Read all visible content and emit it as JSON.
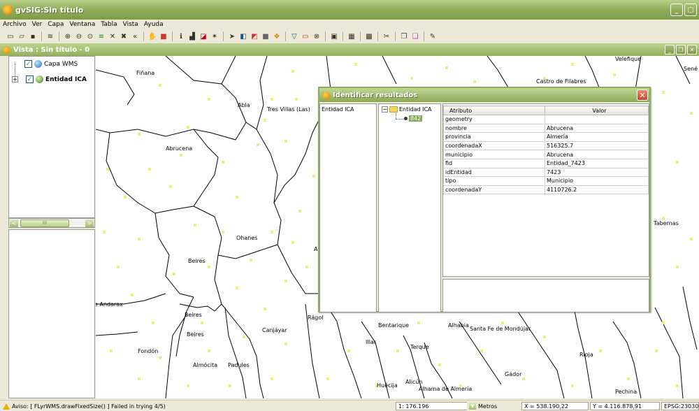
{
  "window": {
    "title": "gvSIG:Sin título"
  },
  "menu": [
    "Archivo",
    "Ver",
    "Capa",
    "Ventana",
    "Tabla",
    "Vista",
    "Ayuda"
  ],
  "view": {
    "title": "Vista : Sin título - 0"
  },
  "toc": {
    "layers": [
      {
        "name": "Capa WMS",
        "checked": "✓"
      },
      {
        "name": "Entidad ICA",
        "checked": "✓"
      }
    ],
    "expander": "+"
  },
  "scrollbar": {
    "left": "<",
    "right": ">",
    "thumb": "III"
  },
  "map": {
    "places": [
      "Fiñana",
      "Abla",
      "Tres Villas (Las)",
      "Abrucena",
      "Ohanes",
      "Beires",
      "e Andarax",
      "Beires",
      "Beires",
      "Canjáyar",
      "Rágol",
      "Fondón",
      "Almócita",
      "Padules",
      "Bentarique",
      "Alhabia",
      "Santa Fe de Mondújar",
      "Illar",
      "Terque",
      "Huécija",
      "Alicún",
      "Alhama de Almería",
      "Gádor",
      "Rioja",
      "Pechina",
      "Tabernas",
      "Castro de Filabres",
      "Velefique",
      "Sené",
      "A"
    ]
  },
  "dialog": {
    "title": "Identificar resultados",
    "close": "✕",
    "left_item": "Entidad ICA",
    "tree": {
      "root": "Entidad ICA",
      "child": "842",
      "expander": "−"
    },
    "table": {
      "headers": [
        "Atributo",
        "Valor"
      ],
      "rows": [
        [
          "geometry",
          ""
        ],
        [
          "nombre",
          "Abrucena"
        ],
        [
          "provincia",
          "Almería"
        ],
        [
          "coordenadaX",
          "516325.7"
        ],
        [
          "municipio",
          "Abrucena"
        ],
        [
          "fid",
          "Entidad_7423"
        ],
        [
          "idEntidad",
          "7423"
        ],
        [
          "tipo",
          "Municipio"
        ],
        [
          "coordenadaY",
          "4110726.2"
        ]
      ]
    }
  },
  "status": {
    "warning": "Aviso: [ FLyrWMS.drawFixedSize() ]  Failed in trying 4/5)",
    "scale": "1: 176.196",
    "units": "Metros",
    "x": "X = 538.190,22",
    "y": "Y = 4.116.878,91",
    "epsg": "EPSG:23030"
  },
  "colors": {
    "accent": "#8fac5a",
    "points": "#e9f07a"
  }
}
